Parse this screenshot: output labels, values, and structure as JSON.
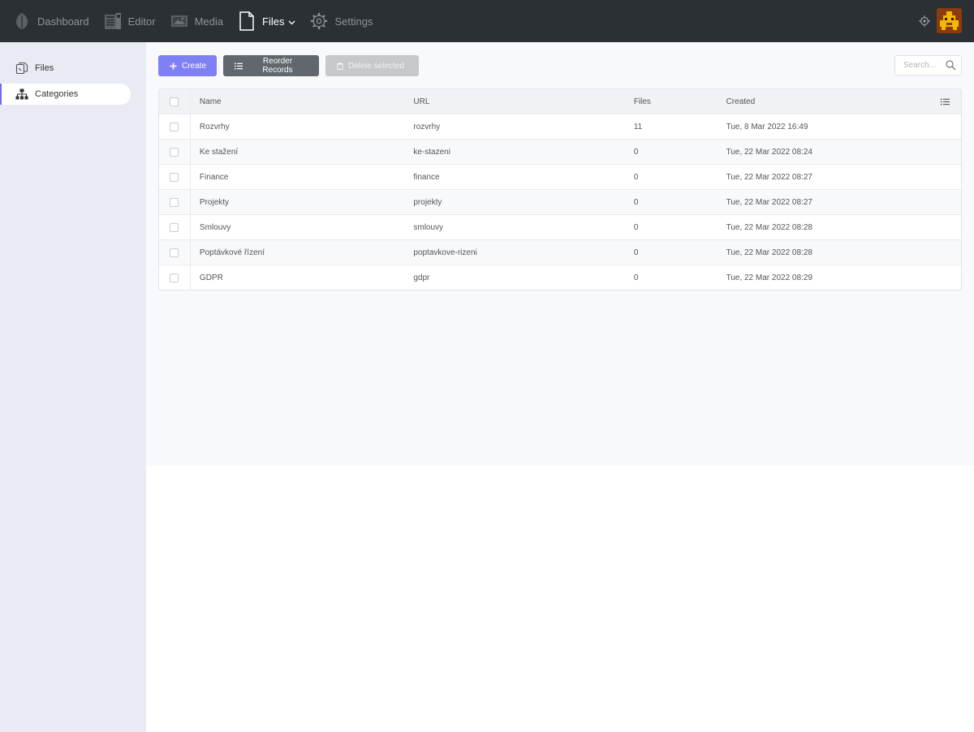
{
  "nav": {
    "items": [
      {
        "label": "Dashboard",
        "icon": "leaf-icon"
      },
      {
        "label": "Editor",
        "icon": "editor-icon"
      },
      {
        "label": "Media",
        "icon": "media-icon"
      },
      {
        "label": "Files",
        "icon": "file-icon",
        "active": true
      },
      {
        "label": "Settings",
        "icon": "gear-icon"
      }
    ]
  },
  "sidebar": {
    "items": [
      {
        "label": "Files",
        "icon": "files-icon"
      },
      {
        "label": "Categories",
        "icon": "sitemap-icon",
        "active": true
      }
    ]
  },
  "toolbar": {
    "create_label": "Create",
    "reorder_label": "Reorder Records",
    "delete_label": "Delete selected"
  },
  "search": {
    "placeholder": "Search..."
  },
  "table": {
    "columns": [
      "Name",
      "URL",
      "Files",
      "Created"
    ],
    "rows": [
      {
        "name": "Rozvrhy",
        "url": "rozvrhy",
        "files": "11",
        "created": "Tue, 8 Mar 2022 16:49"
      },
      {
        "name": "Ke stažení",
        "url": "ke-stazeni",
        "files": "0",
        "created": "Tue, 22 Mar 2022 08:24"
      },
      {
        "name": "Finance",
        "url": "finance",
        "files": "0",
        "created": "Tue, 22 Mar 2022 08:27"
      },
      {
        "name": "Projekty",
        "url": "projekty",
        "files": "0",
        "created": "Tue, 22 Mar 2022 08:27"
      },
      {
        "name": "Smlouvy",
        "url": "smlouvy",
        "files": "0",
        "created": "Tue, 22 Mar 2022 08:28"
      },
      {
        "name": "Poptávkové řízení",
        "url": "poptavkove-rizeni",
        "files": "0",
        "created": "Tue, 22 Mar 2022 08:28"
      },
      {
        "name": "GDPR",
        "url": "gdpr",
        "files": "0",
        "created": "Tue, 22 Mar 2022 08:29"
      }
    ]
  },
  "colors": {
    "topbar": "#2b3035",
    "accent": "#8080f5",
    "sidebar": "#e9ebf4"
  }
}
